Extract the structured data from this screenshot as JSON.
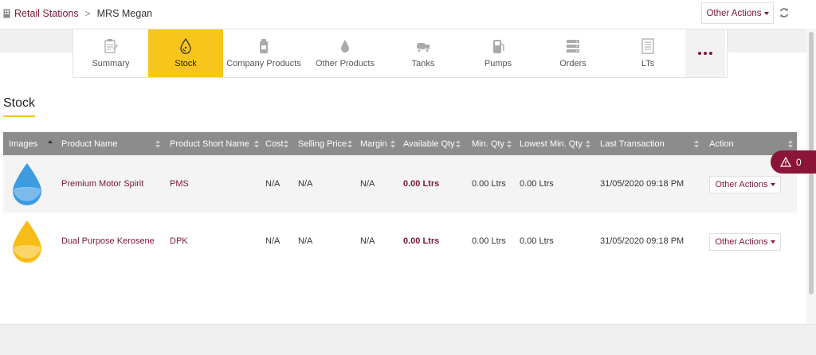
{
  "breadcrumb": {
    "parent": "Retail Stations",
    "current": "MRS Megan"
  },
  "header": {
    "actions_label": "Other Actions"
  },
  "tabs": [
    {
      "label": "Summary",
      "icon": "clipboard-icon"
    },
    {
      "label": "Stock",
      "icon": "oil-drop-icon",
      "active": true
    },
    {
      "label": "Company Products",
      "icon": "bottle-icon"
    },
    {
      "label": "Other Products",
      "icon": "drop-icon"
    },
    {
      "label": "Tanks",
      "icon": "tanker-truck-icon"
    },
    {
      "label": "Pumps",
      "icon": "fuel-pump-icon"
    },
    {
      "label": "Orders",
      "icon": "server-icon"
    },
    {
      "label": "LTs",
      "icon": "list-icon"
    }
  ],
  "section_title": "Stock",
  "table": {
    "columns": [
      "Images",
      "Product Name",
      "Product Short Name",
      "Cost",
      "Selling Price",
      "Margin",
      "Available Qty",
      "Min. Qty",
      "Lowest Min. Qty",
      "Last Transaction",
      "Action"
    ],
    "rows": [
      {
        "image": "blue-drop",
        "name": "Premium Motor Spirit",
        "short": "PMS",
        "cost": "N/A",
        "selling": "N/A",
        "margin": "N/A",
        "available": "0.00 Ltrs",
        "min": "0.00 Ltrs",
        "lowest": "0.00 Ltrs",
        "last": "31/05/2020 09:18 PM",
        "action": "Other Actions"
      },
      {
        "image": "yellow-drop",
        "name": "Dual Purpose Kerosene",
        "short": "DPK",
        "cost": "N/A",
        "selling": "N/A",
        "margin": "N/A",
        "available": "0.00 Ltrs",
        "min": "0.00 Ltrs",
        "lowest": "0.00 Ltrs",
        "last": "31/05/2020 09:18 PM",
        "action": "Other Actions"
      }
    ]
  },
  "alert": {
    "count": "0"
  },
  "colors": {
    "accent": "#f7c51c",
    "brand": "#8a1538",
    "header": "#8c8c8c"
  }
}
